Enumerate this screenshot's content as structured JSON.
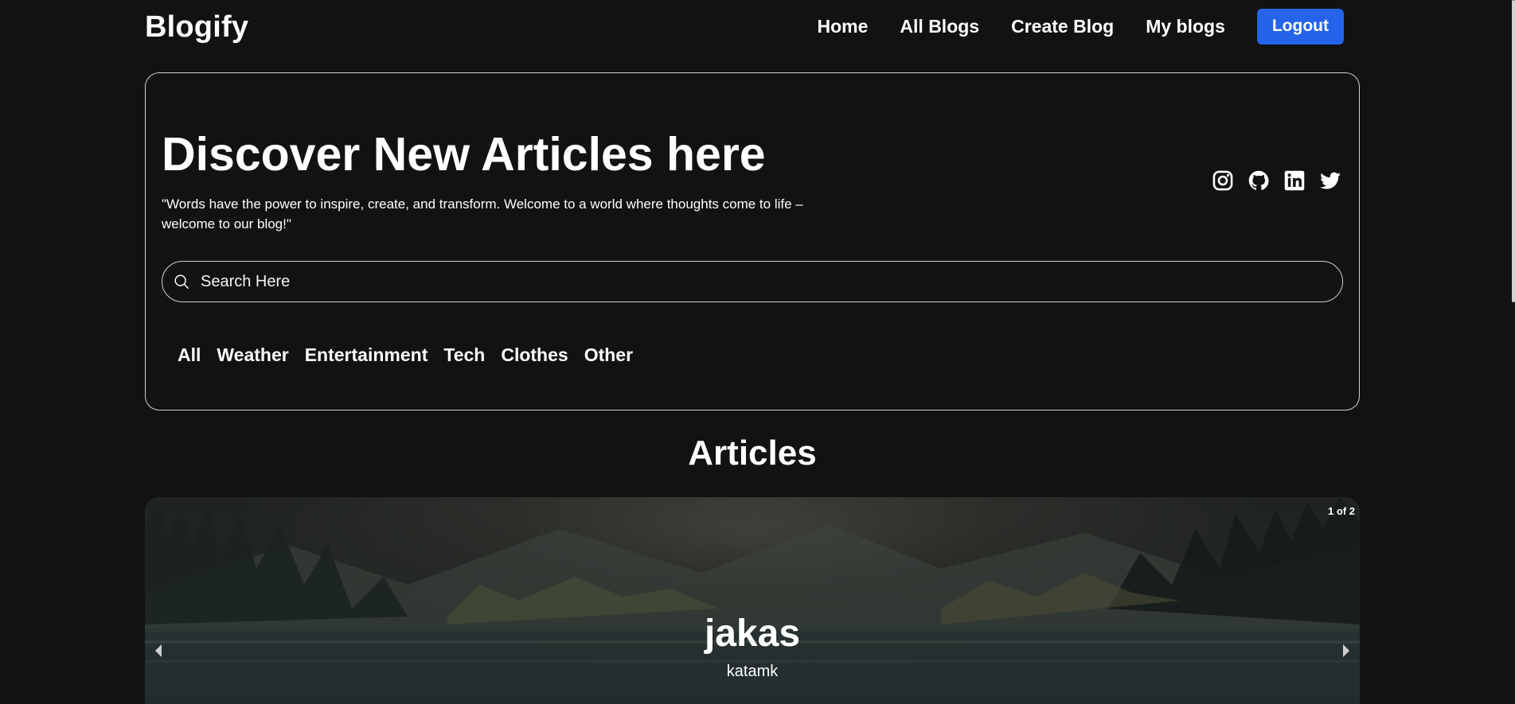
{
  "navbar": {
    "brand": "Blogify",
    "links": [
      "Home",
      "All Blogs",
      "Create Blog",
      "My blogs"
    ],
    "logout_label": "Logout"
  },
  "hero": {
    "title": "Discover New Articles here",
    "subtitle": "\"Words have the power to inspire, create, and transform. Welcome to a world where thoughts come to life – welcome to our blog!\"",
    "social_icons": [
      "instagram-icon",
      "github-icon",
      "linkedin-icon",
      "twitter-icon"
    ],
    "search": {
      "placeholder": "Search Here",
      "value": ""
    },
    "categories": [
      "All",
      "Weather",
      "Entertainment",
      "Tech",
      "Clothes",
      "Other"
    ]
  },
  "articles": {
    "section_title": "Articles",
    "carousel": {
      "counter": "1 of 2",
      "current": 1,
      "total": 2,
      "slide_title": "jakas",
      "slide_author": "katamk"
    }
  },
  "colors": {
    "background": "#121212",
    "accent": "#2563eb",
    "text": "#ffffff",
    "border": "#cfcfcf"
  }
}
